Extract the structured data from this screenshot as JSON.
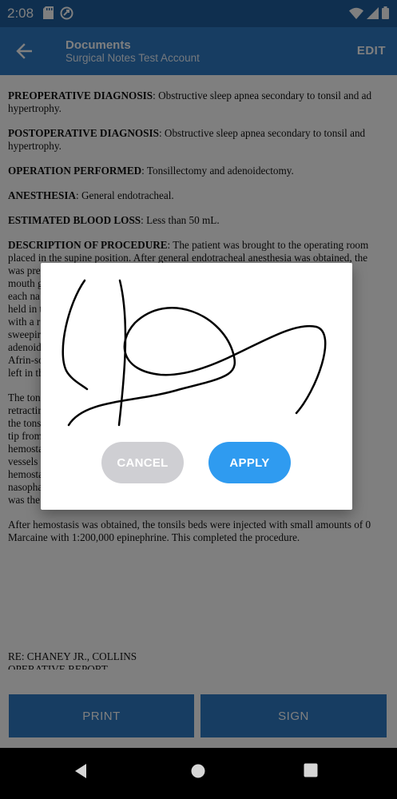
{
  "status_bar": {
    "time": "2:08"
  },
  "app_bar": {
    "title": "Documents",
    "subtitle": "Surgical Notes Test Account",
    "edit_label": "EDIT"
  },
  "document": {
    "paragraphs": [
      {
        "heading": "PREOPERATIVE DIAGNOSIS",
        "lines": [
          "PREOPERATIVE DIAGNOSIS:  Obstructive sleep apnea secondary to tonsil and ad",
          "hypertrophy."
        ]
      },
      {
        "heading": "POSTOPERATIVE DIAGNOSIS",
        "lines": [
          "POSTOPERATIVE DIAGNOSIS:  Obstructive sleep apnea secondary to tonsil and",
          "hypertrophy."
        ]
      },
      {
        "heading": "OPERATION PERFORMED",
        "lines": [
          "OPERATION PERFORMED:  Tonsillectomy and adenoidectomy."
        ]
      },
      {
        "heading": "ANESTHESIA",
        "lines": [
          "ANESTHESIA:  General endotracheal."
        ]
      },
      {
        "heading": "ESTIMATED BLOOD LOSS",
        "lines": [
          "ESTIMATED BLOOD LOSS:  Less than 50 mL."
        ]
      },
      {
        "heading": "DESCRIPTION OF PROCEDURE",
        "lines": [
          "DESCRIPTION OF PROCEDURE:  The patient was brought to the operating room",
          "placed in the supine position.  After general endotracheal anesthesia was obtained, the",
          "was prep                                                                               Crowe",
          "mouth g                                                                              passe",
          "each na                                                                              acted sl",
          "held in                                                                              then ex",
          "with a r                                                                             lation o",
          "sweepir                                                                              rent-siz",
          "adenoid                                                                              . was pa",
          "Afrin-so                                                                             ponges",
          "left in th"
        ]
      },
      {
        "heading": "",
        "lines": [
          "The ton                                                                              n Allis c",
          "retractir                                                                            d imme",
          "the tons                                                                             ire elec",
          "tip from                                                                             entirety",
          "hemosta                                                                              as need",
          "vessels                                                                              ere rem",
          "hemosta                                                                              he pack",
          "nasopha                                                                              utery.",
          "was the"
        ]
      },
      {
        "heading": "",
        "lines": [
          "After hemostasis was obtained, the tonsils beds were injected with small amounts of 0",
          "Marcaine with 1:200,000 epinephrine.  This completed the procedure."
        ]
      }
    ],
    "footer_lines": [
      "RE:  CHANEY JR., COLLINS",
      "OPERATIVE REPORT"
    ]
  },
  "bottom_buttons": {
    "print_label": "PRINT",
    "sign_label": "SIGN"
  },
  "signature_dialog": {
    "cancel_label": "CANCEL",
    "apply_label": "APPLY"
  },
  "colors": {
    "primary": "#2e7bc4",
    "status_bar": "#1f5f9e",
    "apply": "#2f9bf0",
    "cancel": "#cfcfd3"
  },
  "icons": {
    "status_left": [
      "sd-card-icon",
      "vpn-icon"
    ],
    "status_right": [
      "wifi-icon",
      "signal-icon",
      "battery-icon"
    ],
    "app_bar": "arrow-back-icon",
    "nav": [
      "nav-back-icon",
      "nav-home-icon",
      "nav-recents-icon"
    ]
  }
}
